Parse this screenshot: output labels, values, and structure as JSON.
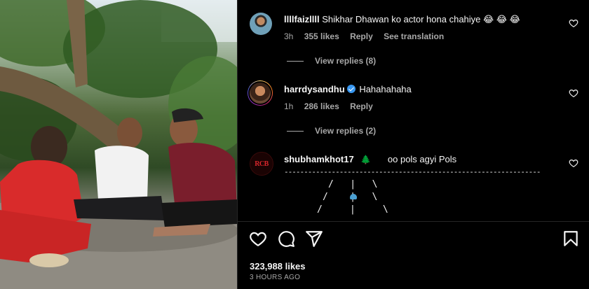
{
  "comments": [
    {
      "username": "llllfaizllll",
      "text": "Shikhar Dhawan ko actor hona chahiye",
      "emojis": "😂 😂 😂",
      "time": "3h",
      "likes": "355 likes",
      "reply": "Reply",
      "translate": "See translation",
      "view_replies": "View replies (8)"
    },
    {
      "username": "harrdysandhu",
      "verified": true,
      "text": "Hahahahaha",
      "time": "1h",
      "likes": "286 likes",
      "reply": "Reply",
      "view_replies": "View replies (2)"
    },
    {
      "username": "shubhamkhot17",
      "avatar_text": "RCB",
      "emoji": "🌲",
      "text": "oo pols agyi Pols",
      "dashes": "-----------------------------------------------------------------",
      "art_lines": [
        "/   |   \\",
        "/    |   \\",
        "/     |     \\"
      ]
    }
  ],
  "post": {
    "likes": "323,988 likes",
    "time": "3 HOURS AGO"
  },
  "icons": {
    "like": "heart-icon",
    "comment": "comment-bubble-icon",
    "share": "send-icon",
    "save": "bookmark-icon"
  },
  "colors": {
    "background": "#000000",
    "text": "#f5f5f5",
    "muted": "#a8a8a8",
    "verified": "#3897f0"
  }
}
